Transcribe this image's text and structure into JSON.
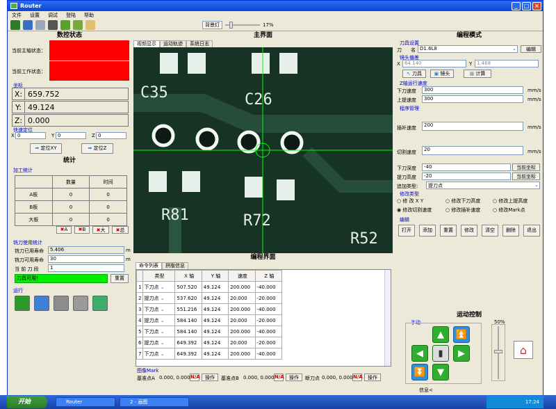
{
  "window": {
    "title": "Router"
  },
  "menu": [
    "文件",
    "设置",
    "调试",
    "登陆",
    "帮助"
  ],
  "toolbar": {
    "bg_light": "背景灯",
    "slider_pct": "17%"
  },
  "left": {
    "section_title": "数控状态",
    "spindle_label": "当前主轴状态：",
    "work_label": "当前工作状态：",
    "coord_group": "坐标",
    "x_label": "X:",
    "x_value": "659.752",
    "y_label": "Y:",
    "y_value": "49.124",
    "z_label": "Z:",
    "z_value": "0.000",
    "quick_group": "快速定位",
    "qx_label": "X",
    "qx_value": "0",
    "qy_label": "Y",
    "qy_value": "0",
    "qz_label": "Z",
    "qz_value": "0",
    "goto_xy": "定位XY",
    "goto_z": "定位Z",
    "stats_title": "统计",
    "proc_group": "加工统计",
    "stats_headers": [
      "",
      "数量",
      "时间"
    ],
    "stats_rows": [
      [
        "A板",
        "0",
        "0"
      ],
      [
        "B板",
        "0",
        "0"
      ],
      [
        "大板",
        "0",
        "0"
      ]
    ],
    "clear_buttons": [
      "A",
      "B",
      "大",
      "总"
    ],
    "mill_group": "铣刀使用统计",
    "used_label": "铣刀已用寿命",
    "used_value": "5.406",
    "avail_label": "铣刀可用寿命",
    "avail_value": "30",
    "unit_m": "m",
    "seg_label": "当 前  刀 段",
    "seg_value": "1",
    "tool_ok": "刀具可用！",
    "reset": "重置",
    "run_group": "运行"
  },
  "center": {
    "title": "主界面",
    "tabs": [
      "视频显示",
      "运动轨迹",
      "系统日志"
    ],
    "board_labels": [
      "C35",
      "C26",
      "R81",
      "R72",
      "R52"
    ],
    "prog_title": "编程界面",
    "prog_tabs": [
      "命令列表",
      "拼版信息"
    ],
    "columns": [
      "",
      "类型",
      "X 轴",
      "Y 轴",
      "速度",
      "Z 轴"
    ],
    "rows": [
      [
        "1",
        "下刀点",
        "507.520",
        "49.124",
        "200.000",
        "-40.000"
      ],
      [
        "2",
        "提刀点",
        "537.620",
        "49.124",
        "20.000",
        "-20.000"
      ],
      [
        "3",
        "下刀点",
        "551.216",
        "49.124",
        "200.000",
        "-40.000"
      ],
      [
        "4",
        "提刀点",
        "584.140",
        "49.124",
        "20.000",
        "-20.000"
      ],
      [
        "5",
        "下刀点",
        "584.140",
        "49.124",
        "200.000",
        "-40.000"
      ],
      [
        "6",
        "提刀点",
        "649.392",
        "49.124",
        "20.000",
        "-20.000"
      ],
      [
        "7",
        "下刀点",
        "649.392",
        "49.124",
        "200.000",
        "-40.000"
      ]
    ],
    "mark_group": "图像Mark",
    "ref_a": "基准点A",
    "ref_a_val": "0.000,  0.000",
    "ref_b": "基准点B",
    "ref_b_val": "0.000,  0.000",
    "brk": "断刀点",
    "brk_val": "0.000,  0.000",
    "na": "N/A",
    "op": "操作"
  },
  "right": {
    "title": "编程模式",
    "tool_group": "刀具设置",
    "tool_label": "刀",
    "name_label": "名",
    "tool_name": "D1.6L8",
    "edit": "编辑",
    "cam_group": "镜头偏差",
    "cam_x": "64.140",
    "cam_y": "1.468",
    "btn_tool": "刀具",
    "btn_cam": "镜头",
    "btn_calc": "计算",
    "z_group": "Z轴运行速度",
    "down_label": "下刀速度",
    "down_val": "300",
    "up_label": "上提速度",
    "up_val": "300",
    "unit": "mm/s",
    "proc_group": "程序管理",
    "feed_label": "插补速度",
    "feed_val": "200",
    "cut_label": "切割速度",
    "cut_val": "20",
    "depth_label": "下刀深度",
    "depth_val": "-40",
    "lift_label": "提刀高度",
    "lift_val": "-20",
    "cur_coord": "当前坐标",
    "add_label": "追加类型:",
    "add_val": "提刀点",
    "mod_group": "修改类型",
    "radios": [
      "修 改 X Y",
      "修改下刀高度",
      "修改上提高度",
      "修改切割速度",
      "修改插补速度",
      "修改Mark点"
    ],
    "edit_group": "编辑",
    "edit_btns": [
      "打开",
      "添加",
      "重置",
      "修改",
      "清空",
      "删除",
      "退出"
    ],
    "motion_title": "运动控制",
    "manual": "手动",
    "pct": "50%",
    "status_label": "信息<"
  },
  "taskbar": {
    "start": "开始",
    "task1": "Router",
    "task2": "2 - 画图",
    "clock": "17:24"
  }
}
